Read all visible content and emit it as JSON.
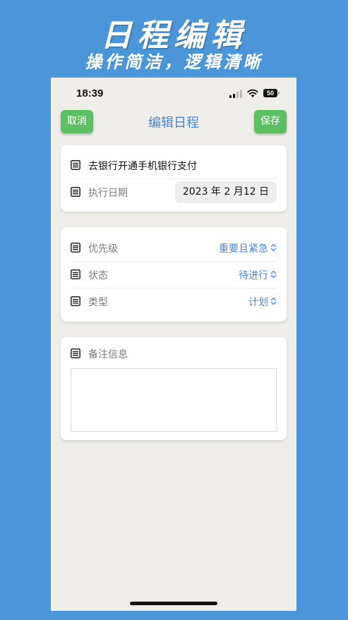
{
  "promo": {
    "title": "日程编辑",
    "subtitle": "操作简洁，逻辑清晰"
  },
  "status_bar": {
    "time": "18:39",
    "battery": "50"
  },
  "nav": {
    "cancel_label": "取消",
    "title": "编辑日程",
    "save_label": "保存"
  },
  "task": {
    "name": "去银行开通手机银行支付",
    "date_label": "执行日期",
    "date_value": "2023 年 2 月12 日"
  },
  "attributes": {
    "priority_label": "优先级",
    "priority_value": "重要且紧急",
    "status_label": "状态",
    "status_value": "待进行",
    "type_label": "类型",
    "type_value": "计划"
  },
  "notes": {
    "label": "备注信息",
    "value": ""
  },
  "icons": {
    "row_icon": "note-icon",
    "picker_icon": "chevron-updown-icon"
  },
  "colors": {
    "background": "#4a96d9",
    "accent_green": "#5cbf63",
    "accent_blue": "#4b86d3"
  }
}
